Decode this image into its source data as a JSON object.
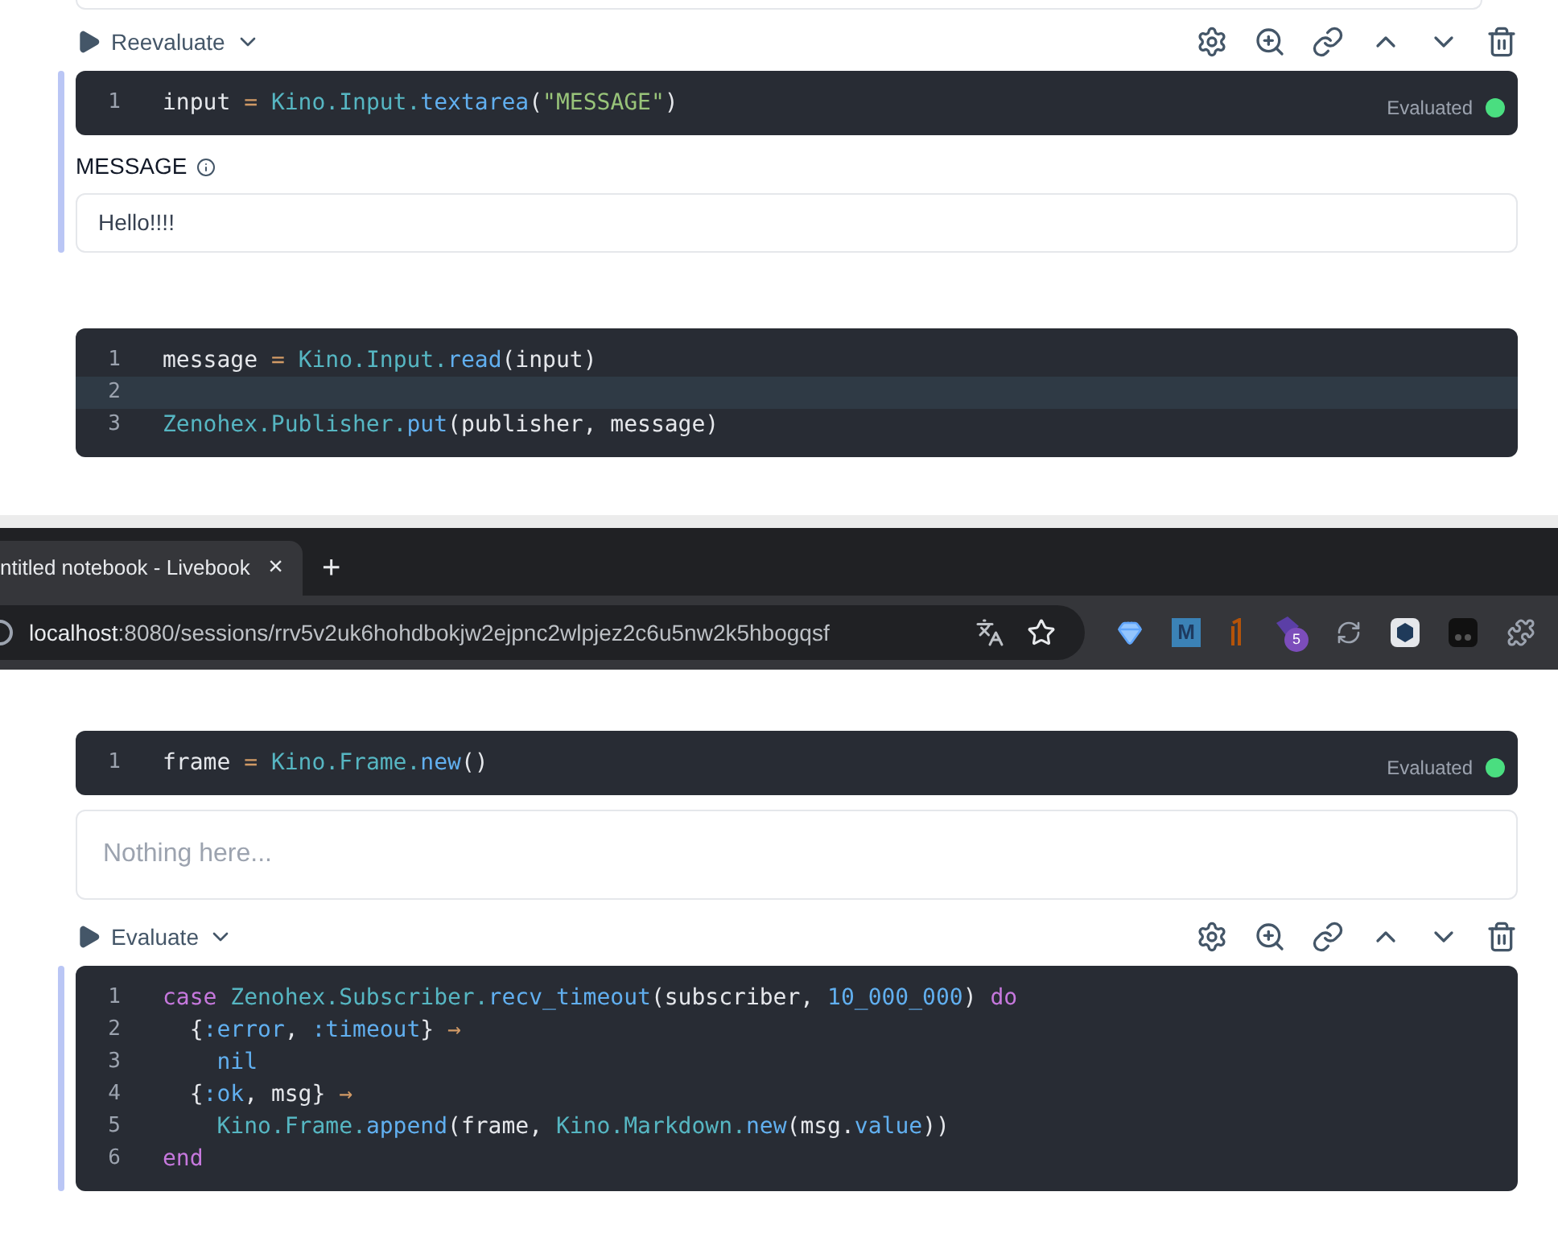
{
  "top_pane": {
    "cells": [
      {
        "kind": "code",
        "toolbar": {
          "action": "Reevaluate"
        },
        "focused": true,
        "status": "Evaluated",
        "lines": [
          {
            "number": "1",
            "current": false,
            "tokens": [
              {
                "text": "input",
                "kind": "plain"
              },
              {
                "text": " = ",
                "kind": "operator"
              },
              {
                "text": "Kino.Input.",
                "kind": "module"
              },
              {
                "text": "textarea",
                "kind": "function"
              },
              {
                "text": "(",
                "kind": "plain"
              },
              {
                "text": "\"MESSAGE\"",
                "kind": "string"
              },
              {
                "text": ")",
                "kind": "plain"
              }
            ]
          }
        ],
        "output": {
          "kind": "input",
          "label": "MESSAGE",
          "value": "Hello!!!!"
        }
      },
      {
        "kind": "code",
        "focused": false,
        "lines": [
          {
            "number": "1",
            "current": false,
            "tokens": [
              {
                "text": "message",
                "kind": "plain"
              },
              {
                "text": " = ",
                "kind": "operator"
              },
              {
                "text": "Kino.Input.",
                "kind": "module"
              },
              {
                "text": "read",
                "kind": "function"
              },
              {
                "text": "(input)",
                "kind": "plain"
              }
            ]
          },
          {
            "number": "2",
            "current": true
          },
          {
            "number": "3",
            "current": false,
            "tokens": [
              {
                "text": "Zenohex.Publisher.",
                "kind": "module"
              },
              {
                "text": "put",
                "kind": "function"
              },
              {
                "text": "(publisher, message)",
                "kind": "plain"
              }
            ]
          }
        ]
      }
    ]
  },
  "browser": {
    "tab": {
      "title": "ntitled notebook - Livebook",
      "close": "×"
    },
    "new_tab": "+",
    "address": {
      "host": "localhost",
      "path": ":8080/sessions/rrv5v2uk6hohdbokjw2ejpnc2wlpjez2c6u5nw2k5hbogqsf"
    },
    "extensions": [
      {
        "kind": "diamond"
      },
      {
        "kind": "letter",
        "label": "M"
      },
      {
        "kind": "tally"
      },
      {
        "kind": "badge",
        "label": "5"
      },
      {
        "kind": "sync"
      },
      {
        "kind": "hex"
      },
      {
        "kind": "dark"
      },
      {
        "kind": "puzzle"
      }
    ]
  },
  "bottom_pane": {
    "cells": [
      {
        "kind": "code",
        "focused": false,
        "status": "Evaluated",
        "lines": [
          {
            "number": "1",
            "current": false,
            "tokens": [
              {
                "text": "frame",
                "kind": "plain"
              },
              {
                "text": " = ",
                "kind": "operator"
              },
              {
                "text": "Kino.Frame.",
                "kind": "module"
              },
              {
                "text": "new",
                "kind": "function"
              },
              {
                "text": "()",
                "kind": "plain"
              }
            ]
          }
        ],
        "output": {
          "kind": "frame",
          "placeholder": "Nothing here..."
        }
      },
      {
        "kind": "code",
        "toolbar": {
          "action": "Evaluate"
        },
        "focused": true,
        "lines": [
          {
            "number": "1",
            "current": false,
            "tokens": [
              {
                "text": "case",
                "kind": "keyword"
              },
              {
                "text": " Zenohex.Subscriber.",
                "kind": "module"
              },
              {
                "text": "recv_timeout",
                "kind": "function"
              },
              {
                "text": "(subscriber, ",
                "kind": "plain"
              },
              {
                "text": "10_000_000",
                "kind": "number"
              },
              {
                "text": ") ",
                "kind": "plain"
              },
              {
                "text": "do",
                "kind": "keyword"
              }
            ]
          },
          {
            "number": "2",
            "current": false,
            "tokens": [
              {
                "text": "  {",
                "kind": "plain"
              },
              {
                "text": ":error",
                "kind": "atom"
              },
              {
                "text": ", ",
                "kind": "plain"
              },
              {
                "text": ":timeout",
                "kind": "atom"
              },
              {
                "text": "} ",
                "kind": "plain"
              },
              {
                "text": "→",
                "kind": "operator"
              }
            ]
          },
          {
            "number": "3",
            "current": false,
            "tokens": [
              {
                "text": "    nil",
                "kind": "atom"
              }
            ]
          },
          {
            "number": "4",
            "current": false,
            "tokens": [
              {
                "text": "  {",
                "kind": "plain"
              },
              {
                "text": ":ok",
                "kind": "atom"
              },
              {
                "text": ", msg} ",
                "kind": "plain"
              },
              {
                "text": "→",
                "kind": "operator"
              }
            ]
          },
          {
            "number": "5",
            "current": false,
            "tokens": [
              {
                "text": "    Kino.Frame.",
                "kind": "module"
              },
              {
                "text": "append",
                "kind": "function"
              },
              {
                "text": "(frame, ",
                "kind": "plain"
              },
              {
                "text": "Kino.Markdown.",
                "kind": "module"
              },
              {
                "text": "new",
                "kind": "function"
              },
              {
                "text": "(msg.",
                "kind": "plain"
              },
              {
                "text": "value",
                "kind": "function"
              },
              {
                "text": "))",
                "kind": "plain"
              }
            ]
          },
          {
            "number": "6",
            "current": false,
            "tokens": [
              {
                "text": "end",
                "kind": "keyword"
              }
            ]
          }
        ]
      }
    ]
  }
}
